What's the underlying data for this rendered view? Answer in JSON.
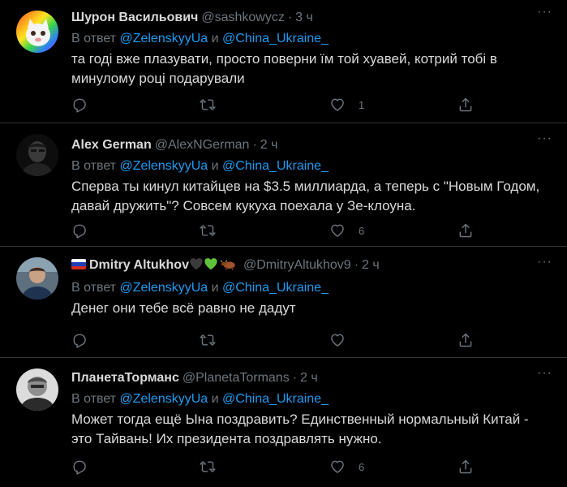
{
  "tweets": [
    {
      "name": "Шурон Васильович",
      "handle": "@sashkowycz",
      "dot": "·",
      "time": "3 ч",
      "reply_prefix": "В ответ ",
      "mention1": "@ZelenskyyUa",
      "reply_and": " и ",
      "mention2": "@China_Ukraine_",
      "text": "та годі вже плазувати, просто поверни їм той хуавей, котрий тобі в минулому році подарували",
      "reply_count": "",
      "retweet_count": "",
      "like_count": "1",
      "avatar": "rainbow-cat-avatar"
    },
    {
      "name": "Alex German",
      "handle": "@AlexNGerman",
      "dot": "·",
      "time": "2 ч",
      "reply_prefix": "В ответ ",
      "mention1": "@ZelenskyyUa",
      "reply_and": " и ",
      "mention2": "@China_Ukraine_",
      "text": "Сперва ты кинул китайцев на $3.5 миллиарда, а теперь с \"Новым Годом, давай дружить\"? Совсем кукуха поехала у Зе-клоуна.",
      "reply_count": "",
      "retweet_count": "",
      "like_count": "6",
      "avatar": "dark-portrait-avatar"
    },
    {
      "name": "Dmitry Altukhov",
      "handle": "@DmitryAltukhov9",
      "dot": "·",
      "time": "2 ч",
      "reply_prefix": "В ответ ",
      "mention1": "@ZelenskyyUa",
      "reply_and": " и ",
      "mention2": "@China_Ukraine_",
      "text": "Денег они тебе всё равно не дадут",
      "reply_count": "",
      "retweet_count": "",
      "like_count": "",
      "avatar": "man-portrait-avatar",
      "name_emojis": [
        "flag-ru",
        "black-heart",
        "green-heart",
        "ox"
      ]
    },
    {
      "name": "ПланетаТорманс",
      "handle": "@PlanetaTormans",
      "dot": "·",
      "time": "2 ч",
      "reply_prefix": "В ответ ",
      "mention1": "@ZelenskyyUa",
      "reply_and": " и ",
      "mention2": "@China_Ukraine_",
      "text": "Может тогда ещё Ына поздравить? Единственный нормальный Китай - это Тайвань! Их президента поздравлять нужно.",
      "reply_count": "",
      "retweet_count": "",
      "like_count": "6",
      "avatar": "bw-portrait-avatar"
    }
  ],
  "more_label": "···",
  "colors": {
    "background": "#000000",
    "text": "#d9d9d9",
    "muted": "#6e767d",
    "mention": "#1d9bf0",
    "divider": "#2f3336"
  }
}
